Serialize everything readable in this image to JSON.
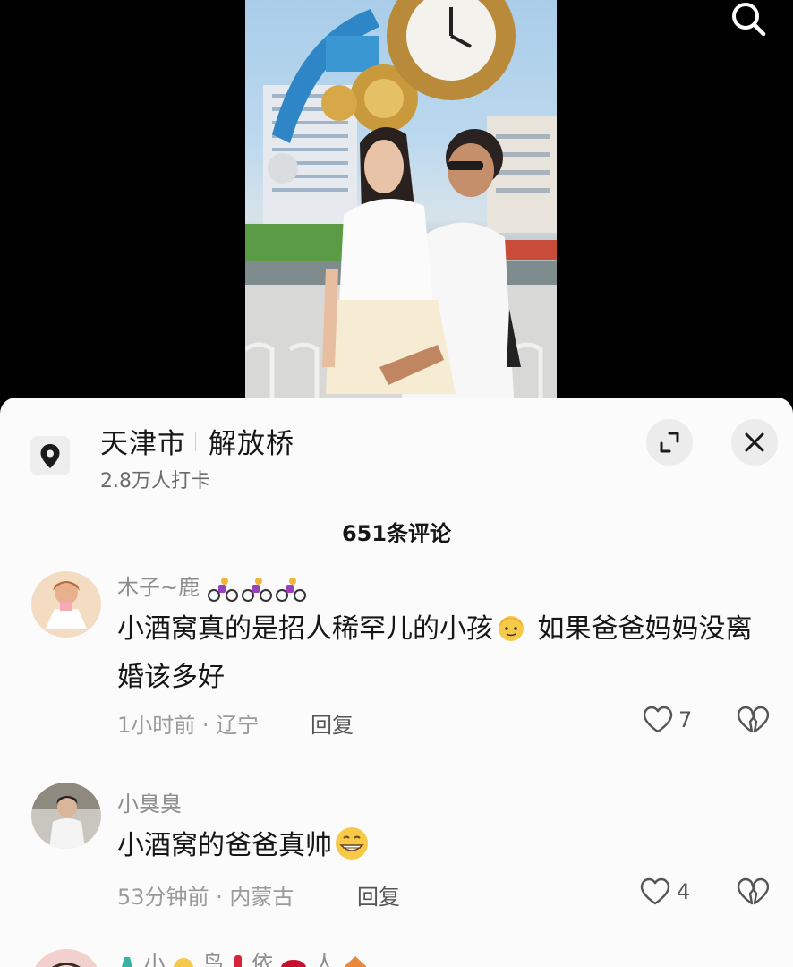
{
  "search": {
    "icon": "search-icon"
  },
  "location": {
    "city": "天津市",
    "place": "解放桥",
    "checkins": "2.8万人打卡"
  },
  "comment_count": "651条评论",
  "comments": [
    {
      "username": "木子~鹿",
      "text": "小酒窝真的是招人稀罕儿的小孩",
      "text_tail": " 如果爸爸妈妈没离婚该多好",
      "time_location": "1小时前 · 辽宁",
      "reply_label": "回复",
      "likes": "7"
    },
    {
      "username": "小臭臭",
      "text": "小酒窝的爸爸真帅",
      "time_location": "53分钟前 · 内蒙古",
      "reply_label": "回复",
      "likes": "4"
    },
    {
      "username_parts": [
        "小",
        "鸟",
        "依",
        "人"
      ]
    }
  ],
  "colors": {
    "sheet_bg": "#fbfbfb",
    "text": "#161616",
    "muted": "#9a9a9a"
  }
}
